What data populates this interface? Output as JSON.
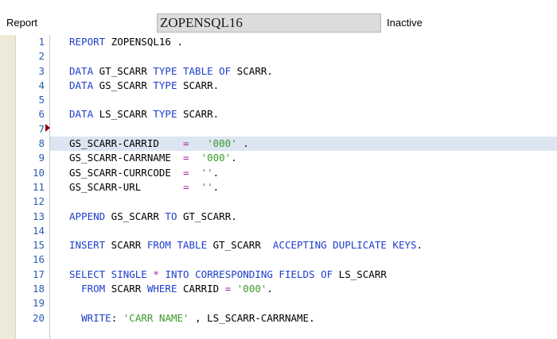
{
  "header": {
    "label": "Report",
    "program_name": "ZOPENSQL16",
    "status": "Inactive"
  },
  "editor": {
    "marker_line": 7,
    "highlight_line": 8,
    "lines": [
      {
        "n": "1",
        "tokens": [
          [
            "kw",
            "REPORT"
          ],
          [
            "n",
            " ZOPENSQL16 ."
          ]
        ]
      },
      {
        "n": "2",
        "tokens": []
      },
      {
        "n": "3",
        "tokens": [
          [
            "kw",
            "DATA"
          ],
          [
            "n",
            " GT_SCARR "
          ],
          [
            "kw",
            "TYPE TABLE OF"
          ],
          [
            "n",
            " SCARR."
          ]
        ]
      },
      {
        "n": "4",
        "tokens": [
          [
            "kw",
            "DATA"
          ],
          [
            "n",
            " GS_SCARR "
          ],
          [
            "kw",
            "TYPE"
          ],
          [
            "n",
            " SCARR."
          ]
        ]
      },
      {
        "n": "5",
        "tokens": []
      },
      {
        "n": "6",
        "tokens": [
          [
            "kw",
            "DATA"
          ],
          [
            "n",
            " LS_SCARR "
          ],
          [
            "kw",
            "TYPE"
          ],
          [
            "n",
            " SCARR."
          ]
        ]
      },
      {
        "n": "7",
        "tokens": []
      },
      {
        "n": "8",
        "tokens": [
          [
            "n",
            "GS_SCARR-CARRID    "
          ],
          [
            "op",
            "="
          ],
          [
            "n",
            "   "
          ],
          [
            "str",
            "'000'"
          ],
          [
            "n",
            " ."
          ]
        ]
      },
      {
        "n": "9",
        "tokens": [
          [
            "n",
            "GS_SCARR-CARRNAME  "
          ],
          [
            "op",
            "="
          ],
          [
            "n",
            "  "
          ],
          [
            "str",
            "'000'"
          ],
          [
            "n",
            "."
          ]
        ]
      },
      {
        "n": "10",
        "tokens": [
          [
            "n",
            "GS_SCARR-CURRCODE  "
          ],
          [
            "op",
            "="
          ],
          [
            "n",
            "  "
          ],
          [
            "str",
            "''"
          ],
          [
            "n",
            "."
          ]
        ]
      },
      {
        "n": "11",
        "tokens": [
          [
            "n",
            "GS_SCARR-URL       "
          ],
          [
            "op",
            "="
          ],
          [
            "n",
            "  "
          ],
          [
            "str",
            "''"
          ],
          [
            "n",
            "."
          ]
        ]
      },
      {
        "n": "12",
        "tokens": []
      },
      {
        "n": "13",
        "tokens": [
          [
            "kw",
            "APPEND"
          ],
          [
            "n",
            " GS_SCARR "
          ],
          [
            "kw",
            "TO"
          ],
          [
            "n",
            " GT_SCARR."
          ]
        ]
      },
      {
        "n": "14",
        "tokens": []
      },
      {
        "n": "15",
        "tokens": [
          [
            "kw",
            "INSERT"
          ],
          [
            "n",
            " SCARR "
          ],
          [
            "kw",
            "FROM TABLE"
          ],
          [
            "n",
            " GT_SCARR  "
          ],
          [
            "kw",
            "ACCEPTING DUPLICATE KEYS"
          ],
          [
            "n",
            "."
          ]
        ]
      },
      {
        "n": "16",
        "tokens": []
      },
      {
        "n": "17",
        "tokens": [
          [
            "kw",
            "SELECT SINGLE"
          ],
          [
            "n",
            " "
          ],
          [
            "op",
            "*"
          ],
          [
            "n",
            " "
          ],
          [
            "kw",
            "INTO CORRESPONDING FIELDS OF"
          ],
          [
            "n",
            " LS_SCARR"
          ]
        ]
      },
      {
        "n": "18",
        "tokens": [
          [
            "n",
            "  "
          ],
          [
            "kw",
            "FROM"
          ],
          [
            "n",
            " SCARR "
          ],
          [
            "kw",
            "WHERE"
          ],
          [
            "n",
            " CARRID "
          ],
          [
            "op",
            "="
          ],
          [
            "n",
            " "
          ],
          [
            "str",
            "'000'"
          ],
          [
            "n",
            "."
          ]
        ]
      },
      {
        "n": "19",
        "tokens": []
      },
      {
        "n": "20",
        "tokens": [
          [
            "n",
            "  "
          ],
          [
            "kw",
            "WRITE"
          ],
          [
            "n",
            ": "
          ],
          [
            "str",
            "'CARR NAME'"
          ],
          [
            "n",
            " , LS_SCARR-CARRNAME."
          ]
        ]
      }
    ]
  }
}
